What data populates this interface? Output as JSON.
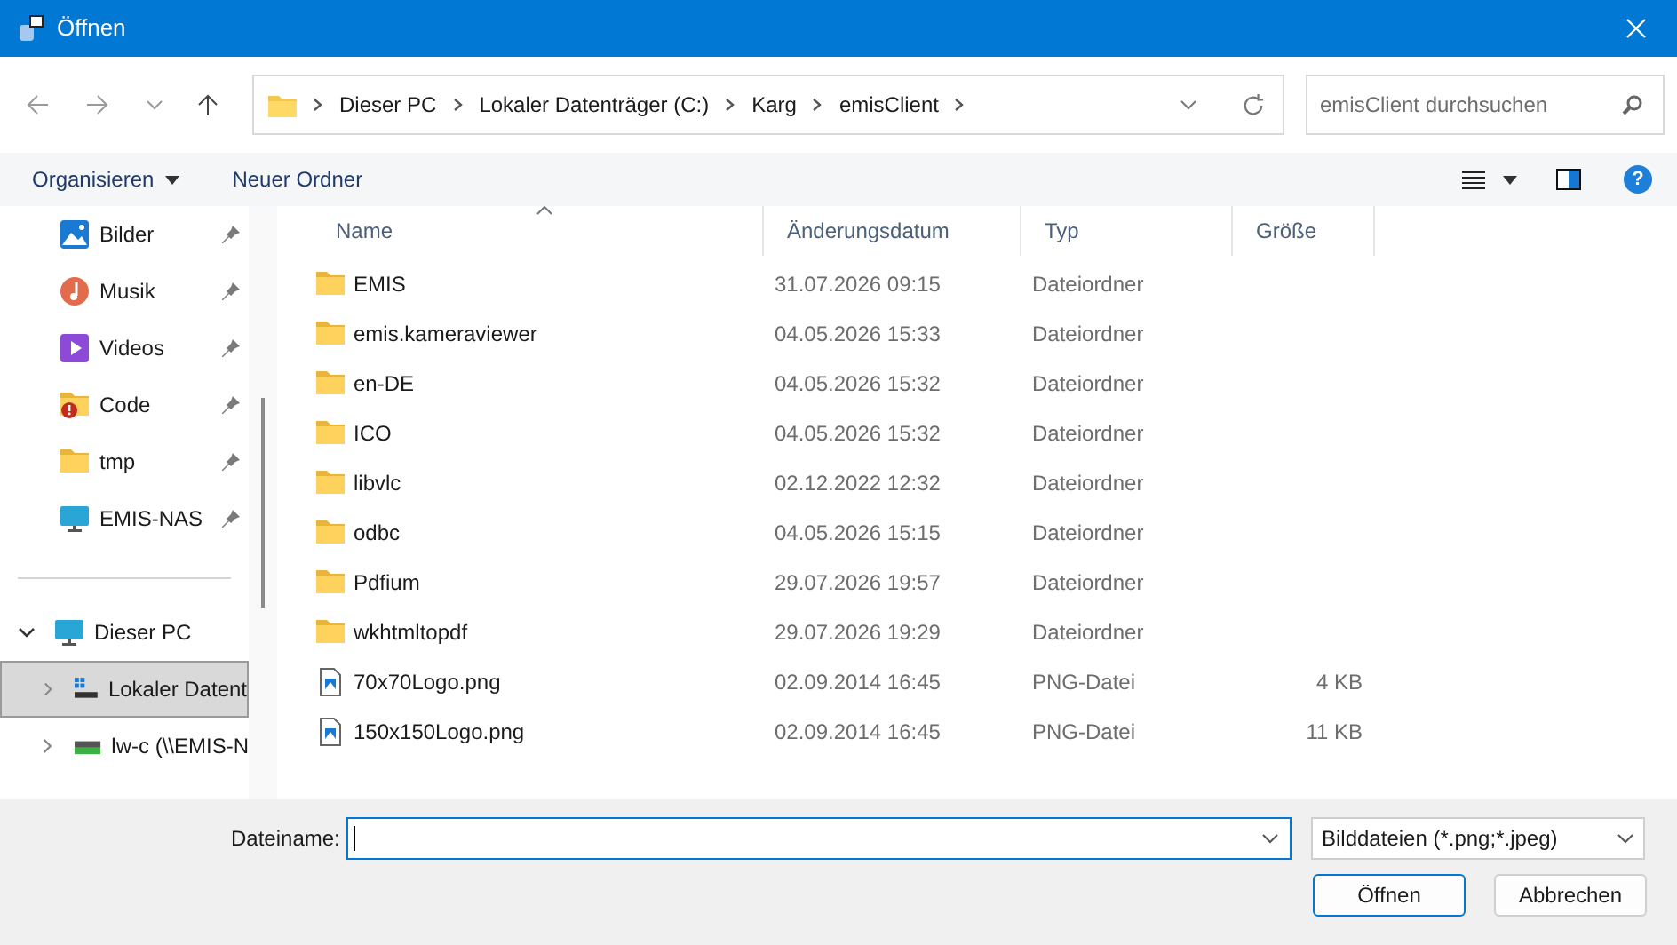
{
  "window": {
    "title": "Öffnen"
  },
  "address_bar": {
    "segments": [
      "Dieser PC",
      "Lokaler Datenträger (C:)",
      "Karg",
      "emisClient"
    ]
  },
  "search": {
    "placeholder": "emisClient durchsuchen"
  },
  "toolbar": {
    "organize": "Organisieren",
    "new_folder": "Neuer Ordner",
    "help": "?"
  },
  "sidebar": {
    "quick_access": [
      {
        "label": "Bilder",
        "kind": "pictures"
      },
      {
        "label": "Musik",
        "kind": "music"
      },
      {
        "label": "Videos",
        "kind": "videos"
      },
      {
        "label": "Code",
        "kind": "folder-alert"
      },
      {
        "label": "tmp",
        "kind": "folder"
      },
      {
        "label": "EMIS-NAS",
        "kind": "monitor"
      }
    ],
    "tree": [
      {
        "label": "Dieser PC",
        "kind": "monitor",
        "expanded": true,
        "selected": false,
        "children": [
          {
            "label": "Lokaler Datent",
            "kind": "drive",
            "expanded": false,
            "selected": true
          },
          {
            "label": "lw-c (\\\\EMIS-N",
            "kind": "netdrive",
            "expanded": false,
            "selected": false
          }
        ]
      }
    ]
  },
  "table": {
    "columns": [
      "Name",
      "Änderungsdatum",
      "Typ",
      "Größe"
    ],
    "rows": [
      {
        "kind": "folder",
        "name": "EMIS",
        "date": "31.07.2026 09:15",
        "type": "Dateiordner"
      },
      {
        "kind": "folder",
        "name": "emis.kameraviewer",
        "date": "04.05.2026 15:33",
        "type": "Dateiordner"
      },
      {
        "kind": "folder",
        "name": "en-DE",
        "date": "04.05.2026 15:32",
        "type": "Dateiordner"
      },
      {
        "kind": "folder",
        "name": "ICO",
        "date": "04.05.2026 15:32",
        "type": "Dateiordner"
      },
      {
        "kind": "folder",
        "name": "libvlc",
        "date": "02.12.2022 12:32",
        "type": "Dateiordner"
      },
      {
        "kind": "folder",
        "name": "odbc",
        "date": "04.05.2026 15:15",
        "type": "Dateiordner"
      },
      {
        "kind": "folder",
        "name": "Pdfium",
        "date": "29.07.2026 19:57",
        "type": "Dateiordner"
      },
      {
        "kind": "folder",
        "name": "wkhtmltopdf",
        "date": "29.07.2026 19:29",
        "type": "Dateiordner"
      },
      {
        "kind": "image",
        "name": "70x70Logo.png",
        "date": "02.09.2014 16:45",
        "type": "PNG-Datei",
        "size": "4 KB"
      },
      {
        "kind": "image",
        "name": "150x150Logo.png",
        "date": "02.09.2014 16:45",
        "type": "PNG-Datei",
        "size": "11 KB"
      }
    ]
  },
  "footer": {
    "filename_label": "Dateiname:",
    "file_type": "Bilddateien (*.png;*.jpeg)",
    "buttons": [
      "Öffnen",
      "Abbrechen"
    ]
  }
}
